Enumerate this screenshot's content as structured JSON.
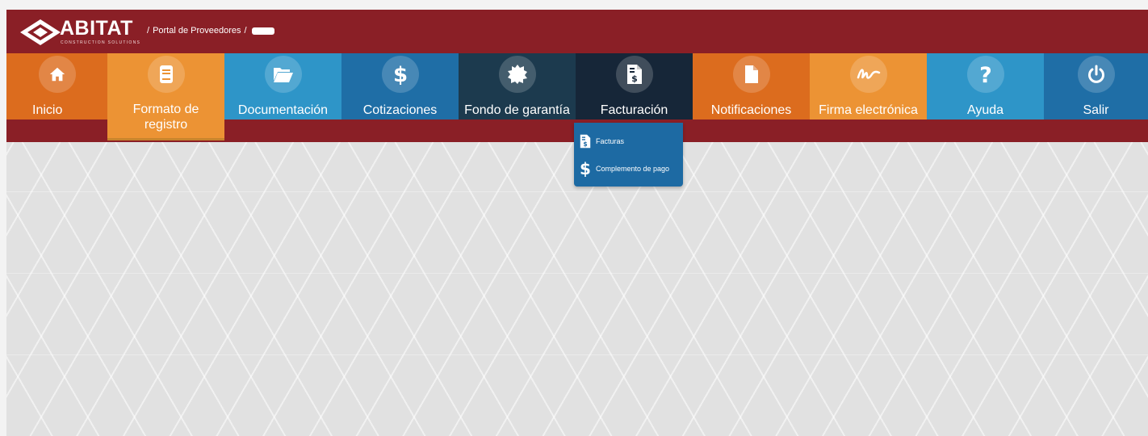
{
  "brand": {
    "name": "ABITAT",
    "tagline": "CONSTRUCTION SOLUTIONS"
  },
  "breadcrumb": {
    "items": [
      "/",
      "Portal de Proveedores",
      "/"
    ]
  },
  "nav": {
    "inicio": "Inicio",
    "formato_line1": "Formato de",
    "formato_line2": "registro",
    "documentacion": "Documentación",
    "cotizaciones": "Cotizaciones",
    "fondo": "Fondo de garantía",
    "facturacion": "Facturación",
    "notificaciones": "Notificaciones",
    "firma": "Firma electrónica",
    "ayuda": "Ayuda",
    "salir": "Salir"
  },
  "dropdown": {
    "facturas": "Facturas",
    "complemento": "Complemento de pago"
  },
  "colors": {
    "header": "#8a1f26",
    "orange_dark": "#dc6c1e",
    "orange": "#ec9334",
    "blue_light": "#2e95c8",
    "blue": "#1f6ea6",
    "navy": "#1c3a4e",
    "navy_dark": "#162638"
  },
  "icons": [
    "home-icon",
    "book-icon",
    "folder-open-icon",
    "dollar-icon",
    "badge-icon",
    "invoice-icon",
    "file-icon",
    "signature-icon",
    "question-icon",
    "power-icon"
  ]
}
